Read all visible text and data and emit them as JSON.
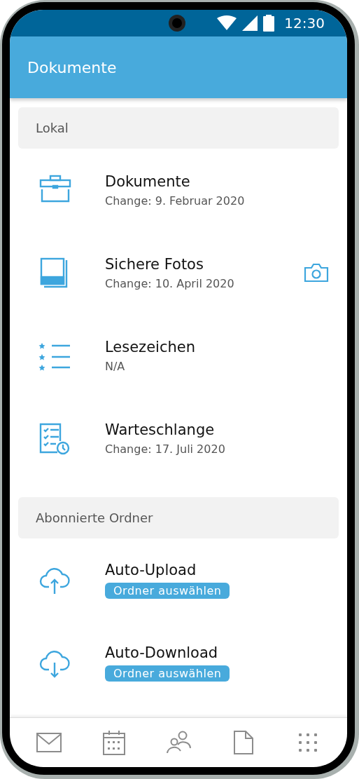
{
  "status_bar": {
    "time": "12:30"
  },
  "app_bar": {
    "title": "Dokumente"
  },
  "sections": [
    {
      "title": "Lokal",
      "items": [
        {
          "kind": "dated",
          "title": "Dokumente",
          "subtitle": "Change: 9. Februar 2020"
        },
        {
          "kind": "dated",
          "title": "Sichere Fotos",
          "subtitle": "Change: 10. April 2020"
        },
        {
          "kind": "dated",
          "title": "Lesezeichen",
          "subtitle": "N/A"
        },
        {
          "kind": "dated",
          "title": "Warteschlange",
          "subtitle": "Change: 17. Juli 2020"
        }
      ]
    },
    {
      "title": "Abonnierte Ordner",
      "items": [
        {
          "kind": "folder-pick",
          "title": "Auto-Upload",
          "button": "Ordner auswählen"
        },
        {
          "kind": "folder-pick",
          "title": "Auto-Download",
          "button": "Ordner auswählen"
        }
      ]
    }
  ]
}
